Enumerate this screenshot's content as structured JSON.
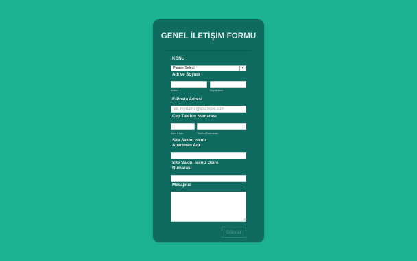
{
  "form": {
    "title": "GENEL İLETİŞİM FORMU",
    "subject": {
      "label": "KONU",
      "selected": "Please Select"
    },
    "name": {
      "label": "Adı ve Soyadı",
      "first_sublabel": "Adınız",
      "last_sublabel": "Soy Adınız"
    },
    "email": {
      "label": "E-Posta Adresi",
      "placeholder": "ex: myname@example.com"
    },
    "phone": {
      "label": "Cep Telefon Numarası",
      "area_sublabel": "Alan Kodu",
      "number_sublabel": "Telefon Numarası"
    },
    "apartment": {
      "label_line1": "Site Sakini iseniz",
      "label_line2": "Apartman Adı"
    },
    "unit": {
      "label_line1": "Site Sakini iseniz Daire",
      "label_line2": "Numarası"
    },
    "message": {
      "label": "Mesajınız"
    },
    "submit_label": "Gönder"
  },
  "colors": {
    "background": "#1bb394",
    "card": "#0f6a5f",
    "title": "#ddeae7"
  }
}
